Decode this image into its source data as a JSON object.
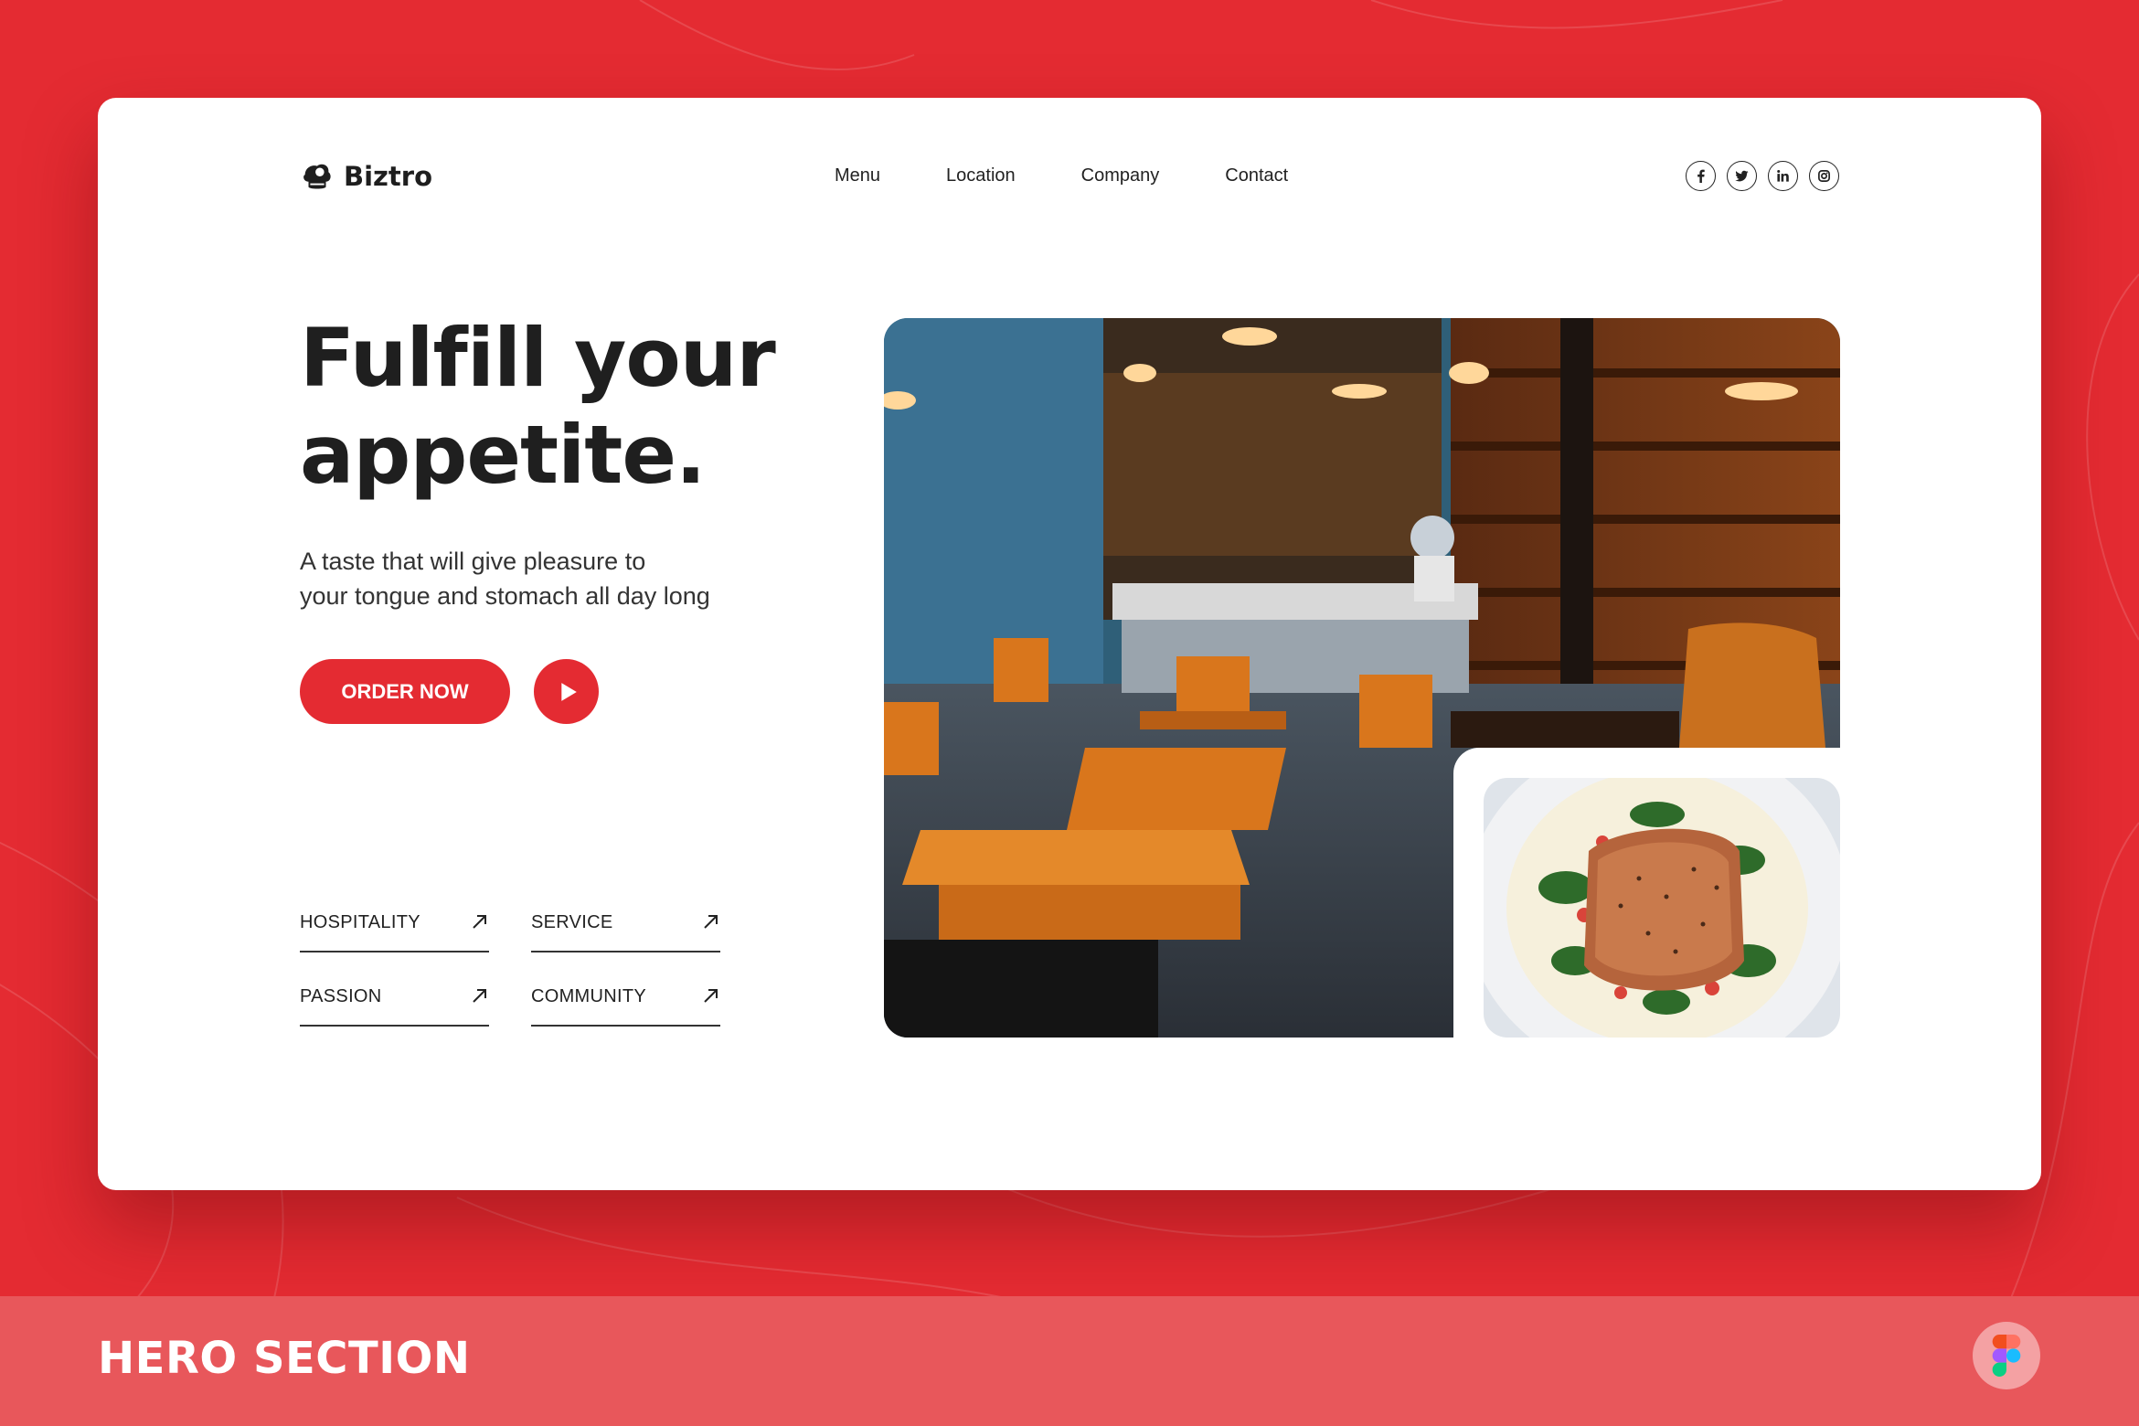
{
  "brand": {
    "name": "Biztro"
  },
  "nav": {
    "items": [
      {
        "label": "Menu"
      },
      {
        "label": "Location"
      },
      {
        "label": "Company"
      },
      {
        "label": "Contact"
      }
    ]
  },
  "socials": [
    {
      "icon": "facebook-icon"
    },
    {
      "icon": "twitter-icon"
    },
    {
      "icon": "linkedin-icon"
    },
    {
      "icon": "instagram-icon"
    }
  ],
  "hero": {
    "headline_line1": "Fulfill your",
    "headline_line2": "appetite.",
    "subtext_line1": "A taste that will give pleasure to",
    "subtext_line2": "your tongue and stomach all day long",
    "order_label": "ORDER NOW",
    "play_icon": "play-icon"
  },
  "features": [
    {
      "label": "HOSPITALITY",
      "icon": "arrow-up-right-icon"
    },
    {
      "label": "SERVICE",
      "icon": "arrow-up-right-icon"
    },
    {
      "label": "PASSION",
      "icon": "arrow-up-right-icon"
    },
    {
      "label": "COMMUNITY",
      "icon": "arrow-up-right-icon"
    }
  ],
  "footer": {
    "title": "HERO SECTION",
    "icon": "figma-icon"
  },
  "colors": {
    "accent": "#e42b32",
    "footer": "#e8575b",
    "text": "#1f1f1f"
  }
}
